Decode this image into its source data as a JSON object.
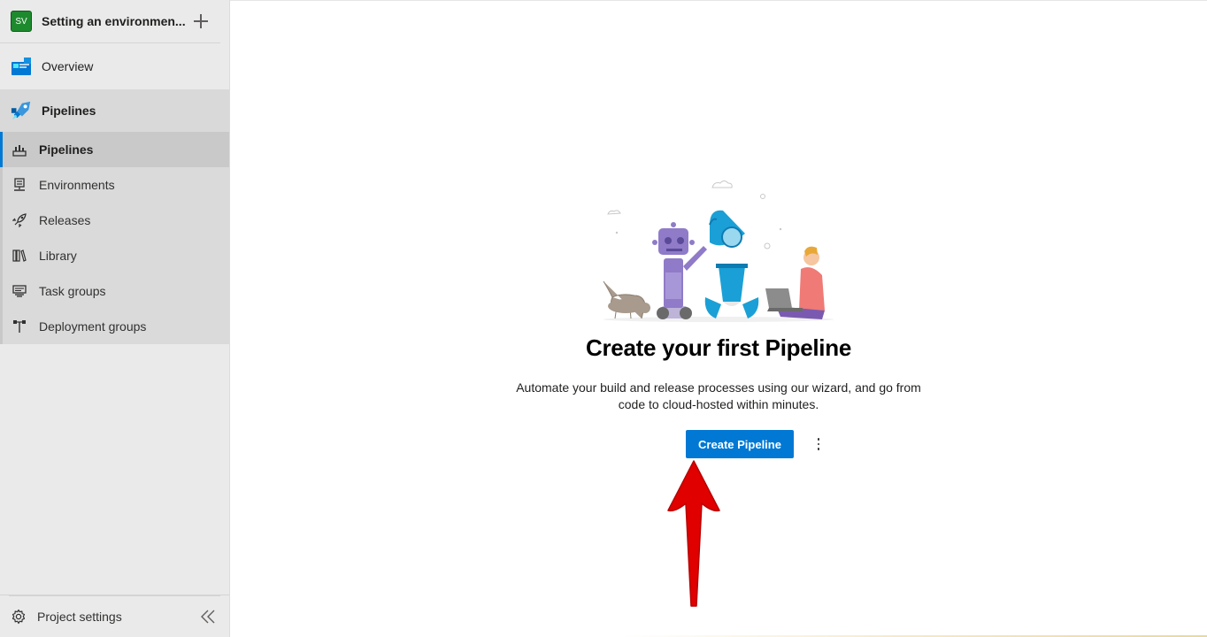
{
  "project": {
    "initials": "SV",
    "name": "Setting an environmen..."
  },
  "nav": {
    "overview": "Overview",
    "pipelines_section": "Pipelines",
    "sub_items": [
      {
        "label": "Pipelines",
        "icon": "pipelines-icon",
        "active": true
      },
      {
        "label": "Environments",
        "icon": "environments-icon",
        "active": false
      },
      {
        "label": "Releases",
        "icon": "releases-icon",
        "active": false
      },
      {
        "label": "Library",
        "icon": "library-icon",
        "active": false
      },
      {
        "label": "Task groups",
        "icon": "task-groups-icon",
        "active": false
      },
      {
        "label": "Deployment groups",
        "icon": "deployment-groups-icon",
        "active": false
      }
    ],
    "project_settings": "Project settings"
  },
  "empty_state": {
    "title": "Create your first Pipeline",
    "description": "Automate your build and release processes using our wizard, and go from code to cloud-hosted within minutes.",
    "primary_button": "Create Pipeline"
  },
  "colors": {
    "accent": "#0078d4",
    "avatar": "#1e8a2e",
    "annotation_arrow": "#e00000"
  }
}
